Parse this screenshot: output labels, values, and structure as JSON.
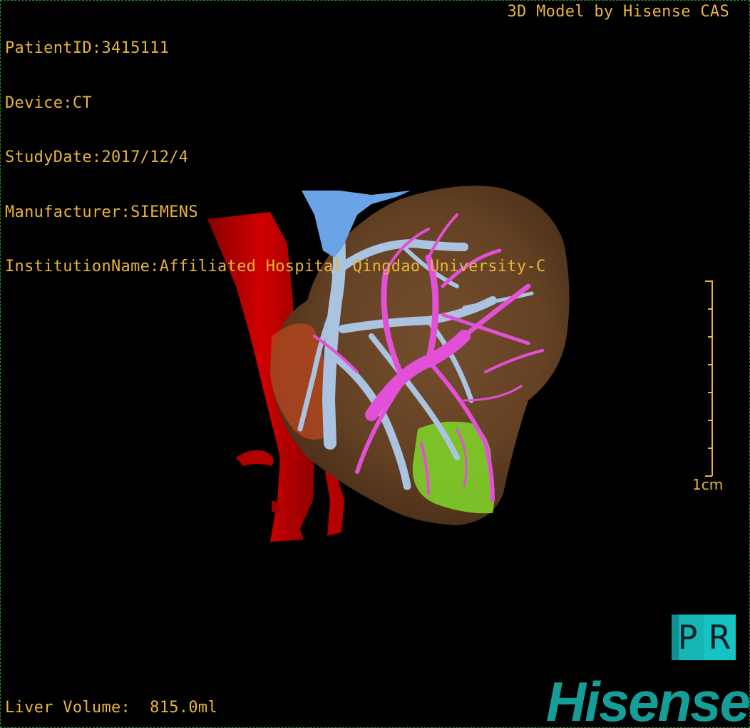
{
  "patient_info": {
    "patient_id": "PatientID:3415111",
    "device": "Device:CT",
    "study_date": "StudyDate:2017/12/4",
    "manufacturer": "Manufacturer:SIEMENS",
    "institution": "InstitutionName:Affiliated Hospital Qingdao University-C"
  },
  "model_credit": "3D Model by Hisense CAS",
  "scale": {
    "label": "1cm"
  },
  "liver_volume": "Liver Volume:  815.0ml",
  "logo": {
    "pr_letters": [
      "P",
      "R"
    ],
    "brand": "Hisense"
  },
  "colors": {
    "overlay_text": "#e8b53a",
    "aorta": "#c40000",
    "portal_vein": "#e350d8",
    "hepatic_vein": "#a9c3e0",
    "ivc_top": "#6aa3e6",
    "liver": "#7a5230",
    "segment": "#7fcf2a",
    "brand": "#159e97"
  },
  "icons": [
    "pr-logo-icon",
    "hisense-logo"
  ]
}
